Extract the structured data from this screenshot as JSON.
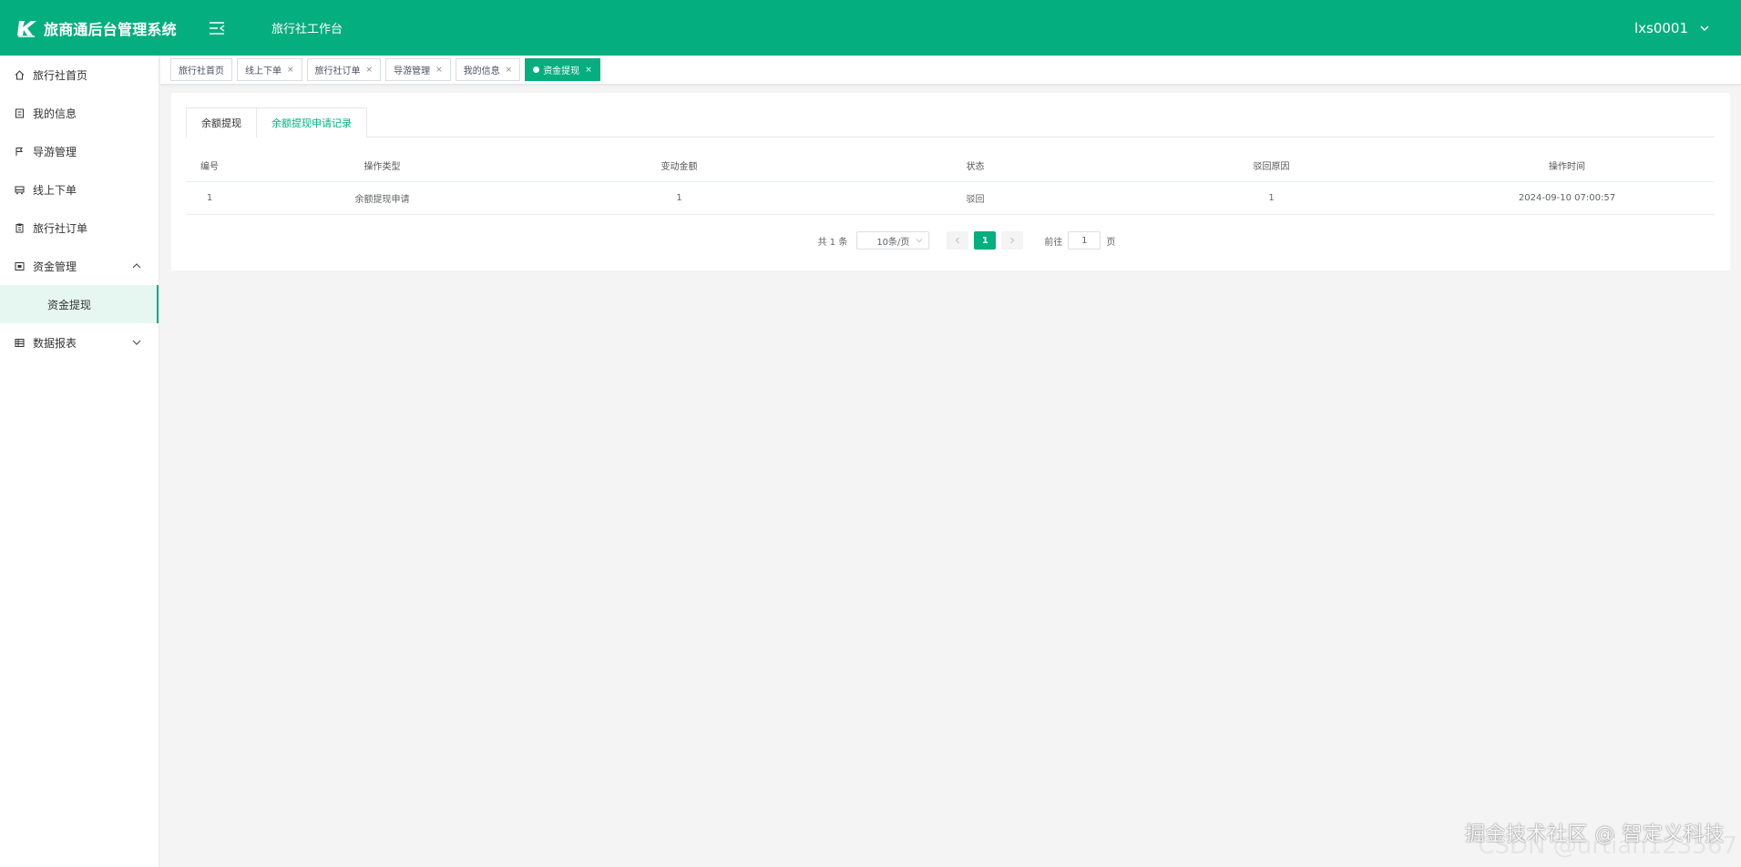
{
  "header": {
    "app_title": "旅商通后台管理系统",
    "workbench": "旅行社工作台",
    "username": "lxs0001"
  },
  "sidebar": {
    "items": [
      {
        "label": "旅行社首页",
        "icon": "home-icon"
      },
      {
        "label": "我的信息",
        "icon": "profile-icon"
      },
      {
        "label": "导游管理",
        "icon": "flag-icon"
      },
      {
        "label": "线上下单",
        "icon": "bus-icon"
      },
      {
        "label": "旅行社订单",
        "icon": "clipboard-icon"
      },
      {
        "label": "资金管理",
        "icon": "wallet-icon",
        "expanded": true
      },
      {
        "label": "数据报表",
        "icon": "report-icon",
        "expanded": false
      }
    ],
    "submenu_active": "资金提现"
  },
  "tags": [
    {
      "label": "旅行社首页"
    },
    {
      "label": "线上下单",
      "close": "×"
    },
    {
      "label": "旅行社订单",
      "close": "×"
    },
    {
      "label": "导游管理",
      "close": "×"
    },
    {
      "label": "我的信息",
      "close": "×"
    },
    {
      "label": "资金提现",
      "close": "×",
      "active": true
    }
  ],
  "tabs": [
    {
      "label": "余额提现"
    },
    {
      "label": "余额提现申请记录",
      "active": true
    }
  ],
  "table": {
    "columns": [
      "编号",
      "操作类型",
      "变动金额",
      "状态",
      "驳回原因",
      "操作时间"
    ],
    "rows": [
      [
        "1",
        "余额提现申请",
        "1",
        "驳回",
        "1",
        "2024-09-10 07:00:57"
      ]
    ]
  },
  "pagination": {
    "total": "共 1 条",
    "page_size": "10条/页",
    "current_page": "1",
    "goto_label": "前往",
    "goto_value": "1",
    "page_suffix": "页"
  },
  "watermark": {
    "text": "掘金技术社区 @ 智定义科技",
    "faint": "CSDN @urtian123567"
  },
  "colors": {
    "primary": "#04ae7f"
  }
}
